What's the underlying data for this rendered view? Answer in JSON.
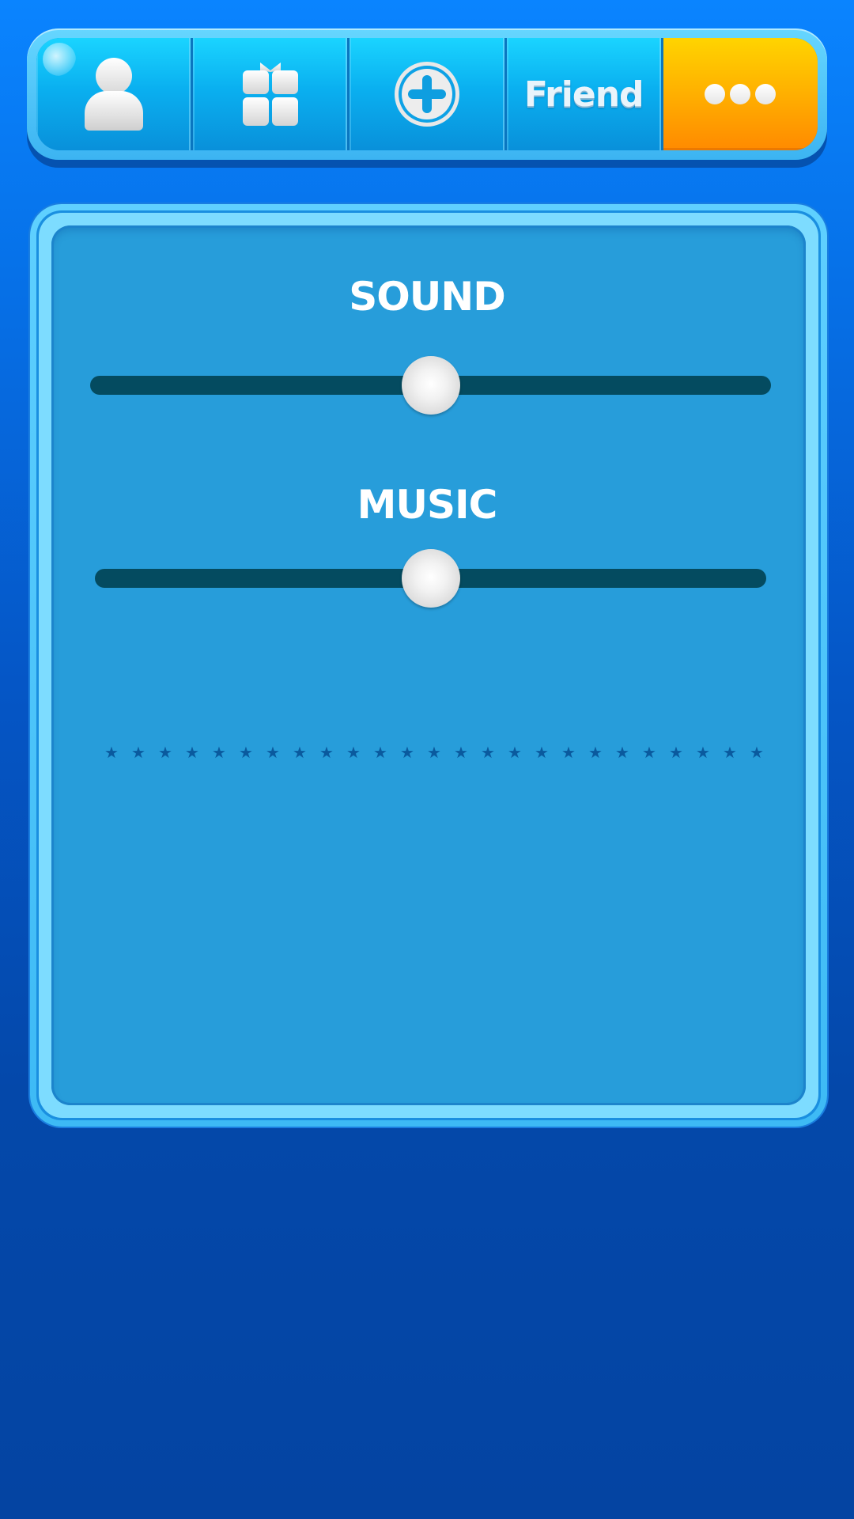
{
  "tabs": [
    {
      "id": "profile",
      "icon": "person-icon",
      "label": ""
    },
    {
      "id": "gifts",
      "icon": "gift-icon",
      "label": ""
    },
    {
      "id": "add",
      "icon": "plus-circle-icon",
      "label": ""
    },
    {
      "id": "friend",
      "icon": "",
      "label": "Friend"
    },
    {
      "id": "more",
      "icon": "ellipsis-icon",
      "label": ""
    }
  ],
  "active_tab": "more",
  "settings": {
    "sound": {
      "label": "SOUND",
      "level": 0.5
    },
    "music": {
      "label": "MUSIC",
      "level": 0.5
    }
  },
  "decoration": {
    "star_count": 25,
    "star_glyph": "★",
    "star_color": "#0a5a9e"
  },
  "colors": {
    "accent_active_tab": "#ffb300",
    "panel_fill": "#279dda",
    "slider_track": "#044b60"
  }
}
